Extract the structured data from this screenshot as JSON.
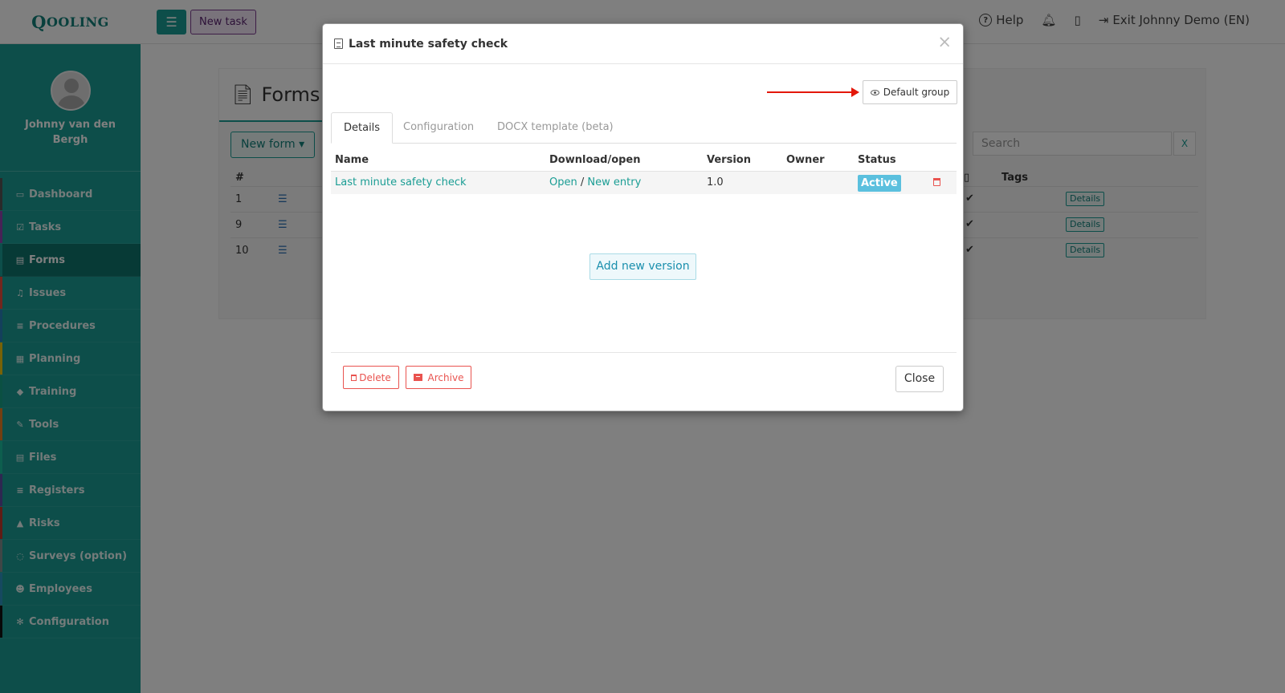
{
  "app": {
    "logo": "QOOLING",
    "logo_first": "Q",
    "logo_rest": "OOLING"
  },
  "header": {
    "new_task_label": "New task",
    "help_label": "Help",
    "exit_label": "Exit Johnny Demo (EN)"
  },
  "sidebar": {
    "user_name": "Johnny van den Bergh",
    "items": [
      {
        "label": "Dashboard",
        "icon": "monitor-icon",
        "color": "#555555"
      },
      {
        "label": "Tasks",
        "icon": "checkbox-icon",
        "color": "#8e44ad"
      },
      {
        "label": "Forms",
        "icon": "file-icon",
        "color": "#1a9d94"
      },
      {
        "label": "Issues",
        "icon": "bell-icon",
        "color": "#e74c3c"
      },
      {
        "label": "Procedures",
        "icon": "list-icon",
        "color": "#2980b9"
      },
      {
        "label": "Planning",
        "icon": "calendar-icon",
        "color": "#f1c40f"
      },
      {
        "label": "Training",
        "icon": "graduation-cap-icon",
        "color": "#16a085"
      },
      {
        "label": "Tools",
        "icon": "wrench-icon",
        "color": "#e67e22"
      },
      {
        "label": "Files",
        "icon": "file-icon",
        "color": "#1abc9c"
      },
      {
        "label": "Registers",
        "icon": "list-icon",
        "color": "#5d4fa3"
      },
      {
        "label": "Risks",
        "icon": "warning-icon",
        "color": "#c0392b"
      },
      {
        "label": "Surveys (option)",
        "icon": "comment-icon",
        "color": "#7f8c8d"
      },
      {
        "label": "Employees",
        "icon": "users-icon",
        "color": "#2c92c0"
      },
      {
        "label": "Configuration",
        "icon": "gear-icon",
        "color": "#111111"
      }
    ],
    "active_index": 2
  },
  "forms_page": {
    "title": "Forms",
    "new_form_label": "New form",
    "search_placeholder": "Search",
    "search_clear": "X",
    "columns": {
      "num": "#",
      "tags": "Tags"
    },
    "rows": [
      {
        "num": "1",
        "details": "Details"
      },
      {
        "num": "9",
        "details": "Details"
      },
      {
        "num": "10",
        "details": "Details"
      }
    ]
  },
  "modal": {
    "title": "Last minute safety check",
    "close_symbol": "×",
    "default_group_label": "Default group",
    "annotation_arrow_color": "#e3170a",
    "tabs": [
      "Details",
      "Configuration",
      "DOCX template (beta)"
    ],
    "active_tab": 0,
    "table": {
      "headers": [
        "Name",
        "Download/open",
        "Version",
        "Owner",
        "Status"
      ],
      "row": {
        "name": "Last minute safety check",
        "open": "Open",
        "separator": "/",
        "new_entry": "New entry",
        "version": "1.0",
        "owner": "",
        "status": "Active"
      }
    },
    "add_version_label": "Add new version",
    "footer": {
      "delete_label": "Delete",
      "archive_label": "Archive",
      "close_label": "Close"
    }
  },
  "colors": {
    "brand": "#1a9d94",
    "danger": "#e9534f",
    "info": "#5bc0de"
  }
}
